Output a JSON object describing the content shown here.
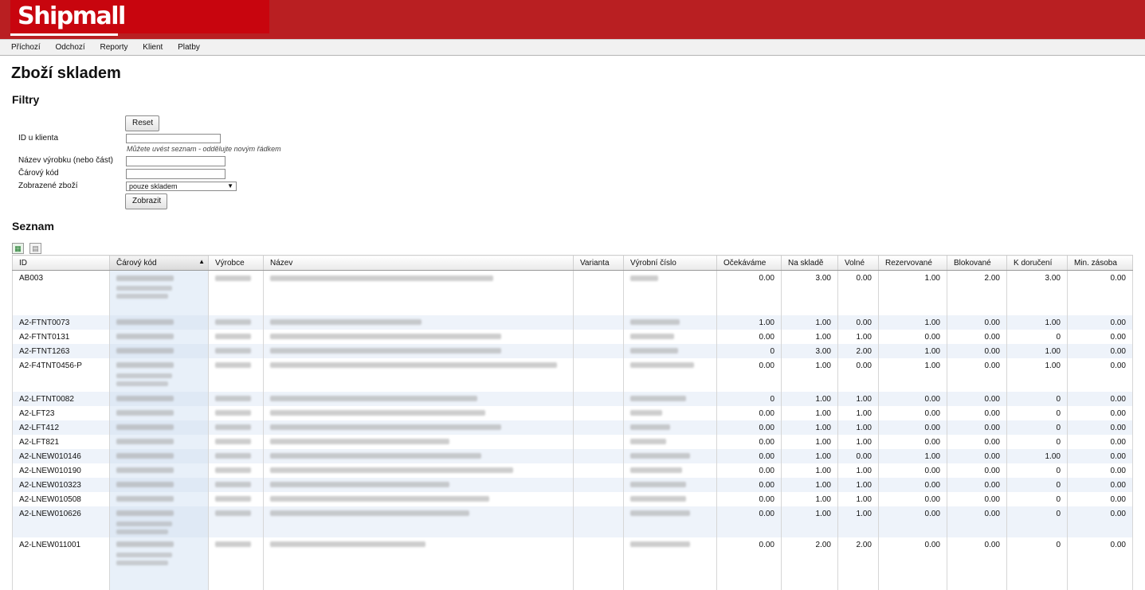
{
  "brand": {
    "name": "Shipmall"
  },
  "menu": [
    "Příchozí",
    "Odchozí",
    "Reporty",
    "Klient",
    "Platby"
  ],
  "page": {
    "title": "Zboží skladem"
  },
  "filters": {
    "heading": "Filtry",
    "reset_label": "Reset",
    "client_id_label": "ID u klienta",
    "client_id_hint": "Můžete uvést seznam - oddělujte novým řádkem",
    "name_label": "Název výrobku (nebo část)",
    "barcode_label": "Čárový kód",
    "shown_goods_label": "Zobrazené zboží",
    "shown_goods_value": "pouze skladem",
    "submit_label": "Zobrazit"
  },
  "list": {
    "heading": "Seznam",
    "columns": [
      "ID",
      "Čárový kód",
      "Výrobce",
      "Název",
      "Varianta",
      "Výrobní číslo",
      "Očekáváme",
      "Na skladě",
      "Volné",
      "Rezervované",
      "Blokované",
      "K doručení",
      "Min. zásoba"
    ],
    "sorted_column": "Čárový kód",
    "rows": [
      {
        "id": "AB003",
        "vals": [
          "0.00",
          "3.00",
          "0.00",
          "1.00",
          "2.00",
          "3.00",
          "0.00"
        ]
      },
      {
        "id": "A2-FTNT0073",
        "vals": [
          "1.00",
          "1.00",
          "0.00",
          "1.00",
          "0.00",
          "1.00",
          "0.00"
        ]
      },
      {
        "id": "A2-FTNT0131",
        "vals": [
          "0.00",
          "1.00",
          "1.00",
          "0.00",
          "0.00",
          "0",
          "0.00"
        ]
      },
      {
        "id": "A2-FTNT1263",
        "vals": [
          "0",
          "3.00",
          "2.00",
          "1.00",
          "0.00",
          "1.00",
          "0.00"
        ]
      },
      {
        "id": "A2-F4TNT0456-P",
        "vals": [
          "0.00",
          "1.00",
          "0.00",
          "1.00",
          "0.00",
          "1.00",
          "0.00"
        ]
      },
      {
        "id": "A2-LFTNT0082",
        "vals": [
          "0",
          "1.00",
          "1.00",
          "0.00",
          "0.00",
          "0",
          "0.00"
        ]
      },
      {
        "id": "A2-LFT23",
        "vals": [
          "0.00",
          "1.00",
          "1.00",
          "0.00",
          "0.00",
          "0",
          "0.00"
        ]
      },
      {
        "id": "A2-LFT412",
        "vals": [
          "0.00",
          "1.00",
          "1.00",
          "0.00",
          "0.00",
          "0",
          "0.00"
        ]
      },
      {
        "id": "A2-LFT821",
        "vals": [
          "0.00",
          "1.00",
          "1.00",
          "0.00",
          "0.00",
          "0",
          "0.00"
        ]
      },
      {
        "id": "A2-LNEW010146",
        "vals": [
          "0.00",
          "1.00",
          "0.00",
          "1.00",
          "0.00",
          "1.00",
          "0.00"
        ]
      },
      {
        "id": "A2-LNEW010190",
        "vals": [
          "0.00",
          "1.00",
          "1.00",
          "0.00",
          "0.00",
          "0",
          "0.00"
        ]
      },
      {
        "id": "A2-LNEW010323",
        "vals": [
          "0.00",
          "1.00",
          "1.00",
          "0.00",
          "0.00",
          "0",
          "0.00"
        ]
      },
      {
        "id": "A2-LNEW010508",
        "vals": [
          "0.00",
          "1.00",
          "1.00",
          "0.00",
          "0.00",
          "0",
          "0.00"
        ]
      },
      {
        "id": "A2-LNEW010626",
        "vals": [
          "0.00",
          "1.00",
          "1.00",
          "0.00",
          "0.00",
          "0",
          "0.00"
        ]
      },
      {
        "id": "A2-LNEW011001",
        "vals": [
          "0.00",
          "2.00",
          "2.00",
          "0.00",
          "0.00",
          "0",
          "0.00"
        ]
      }
    ]
  },
  "icons": {
    "export_xls": "excel-export-icon",
    "export_pdf": "pdf-export-icon"
  },
  "colors": {
    "brand_red": "#b91f22",
    "logo_red": "#c8050e",
    "alt_row": "#eef3fa"
  }
}
